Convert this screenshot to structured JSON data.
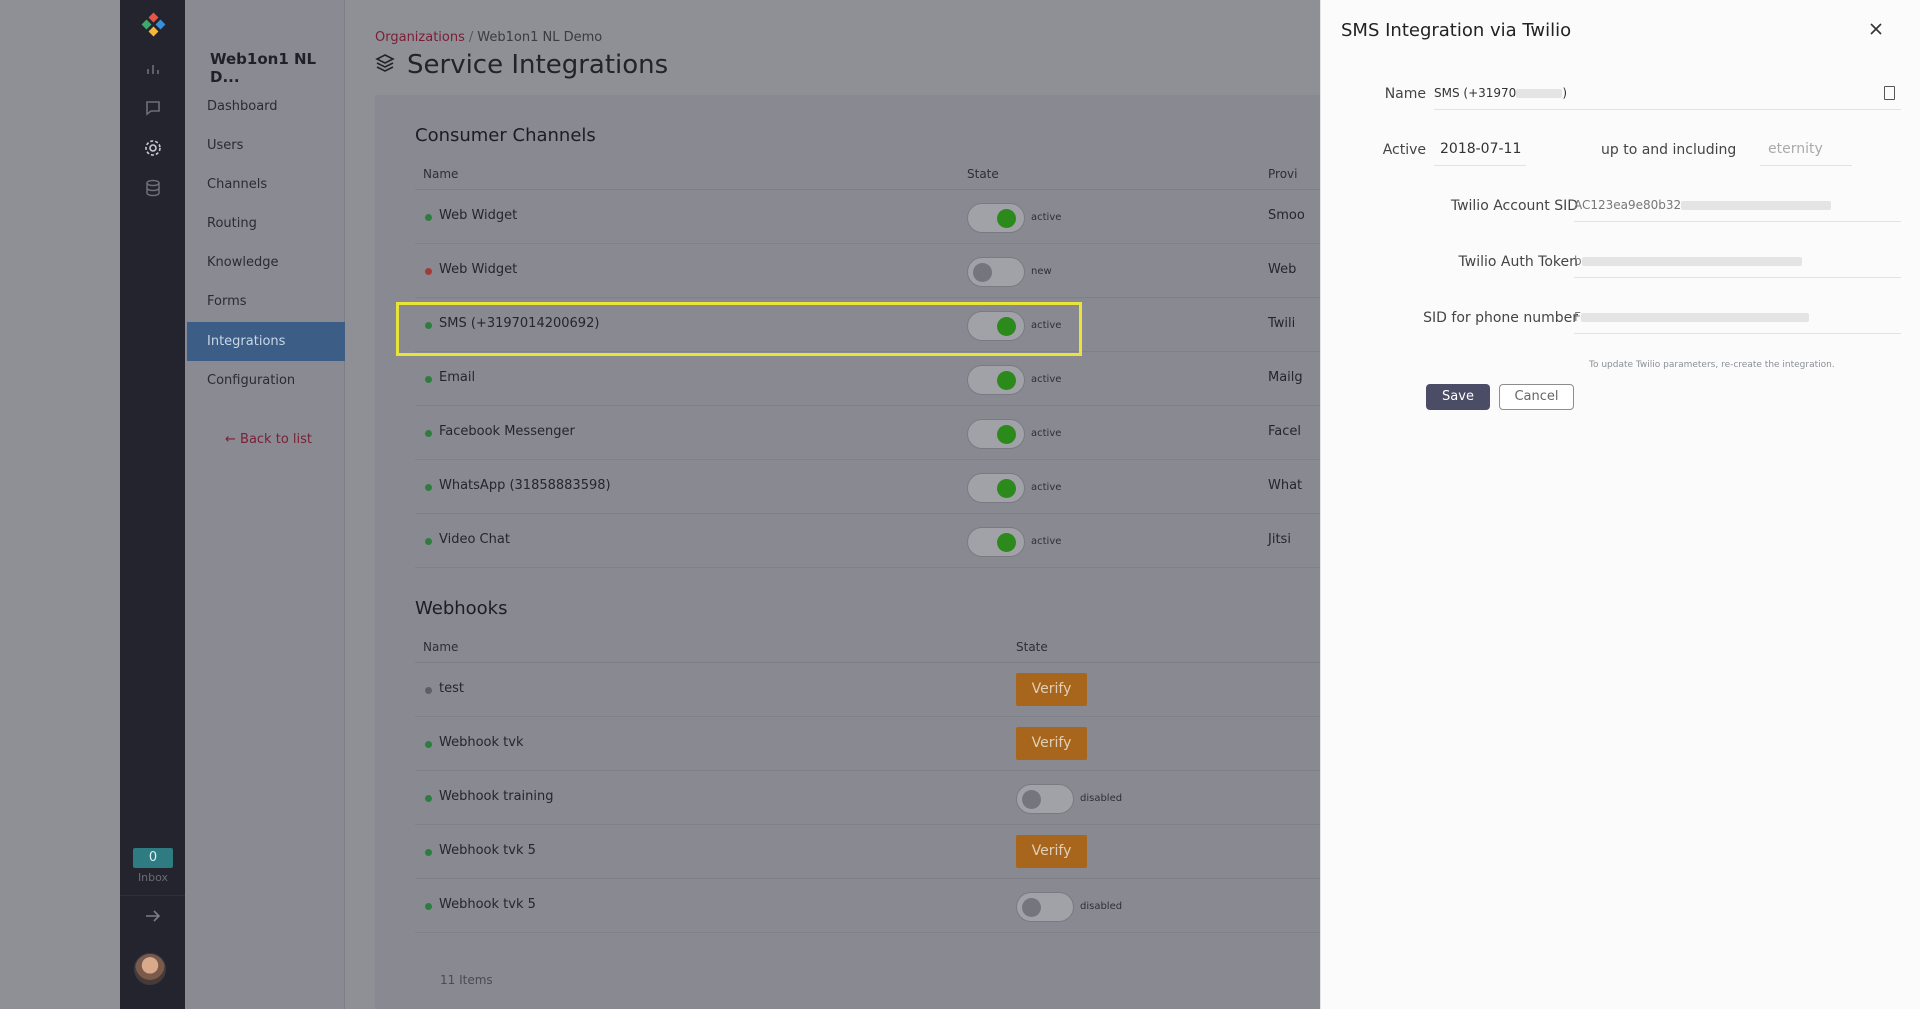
{
  "sidebar": {
    "org_name": "Web1on1 NL D...",
    "items": [
      {
        "label": "Dashboard"
      },
      {
        "label": "Users"
      },
      {
        "label": "Channels"
      },
      {
        "label": "Routing"
      },
      {
        "label": "Knowledge"
      },
      {
        "label": "Forms"
      },
      {
        "label": "Integrations",
        "active": true
      },
      {
        "label": "Configuration"
      }
    ],
    "back_label": "← Back to list"
  },
  "rail": {
    "icons": [
      "logo-icon",
      "chart-icon",
      "chat-icon",
      "gear-icon",
      "database-icon"
    ],
    "inbox_count": "0",
    "inbox_label": "Inbox"
  },
  "header": {
    "breadcrumb_root": "Organizations",
    "breadcrumb_sep": "/",
    "breadcrumb_current": "Web1on1 NL Demo",
    "title": "Service Integrations"
  },
  "consumer_channels": {
    "title": "Consumer Channels",
    "col_name": "Name",
    "col_state": "State",
    "col_provider": "Provi",
    "rows": [
      {
        "name": "Web Widget",
        "state": "active",
        "on": true,
        "provider": "Smoo",
        "dot": "green"
      },
      {
        "name": "Web Widget",
        "state": "new",
        "on": false,
        "provider": "Web",
        "dot": "red"
      },
      {
        "name": "SMS (+3197014200692)",
        "state": "active",
        "on": true,
        "provider": "Twili",
        "dot": "green"
      },
      {
        "name": "Email",
        "state": "active",
        "on": true,
        "provider": "Mailg",
        "dot": "green"
      },
      {
        "name": "Facebook Messenger",
        "state": "active",
        "on": true,
        "provider": "Facel",
        "dot": "green"
      },
      {
        "name": "WhatsApp (31858883598)",
        "state": "active",
        "on": true,
        "provider": "What",
        "dot": "green"
      },
      {
        "name": "Video Chat",
        "state": "active",
        "on": true,
        "provider": "Jitsi",
        "dot": "green"
      }
    ]
  },
  "webhooks": {
    "title": "Webhooks",
    "col_name": "Name",
    "col_state": "State",
    "verify_label": "Verify",
    "rows": [
      {
        "name": "test",
        "kind": "verify",
        "dot": "grey"
      },
      {
        "name": "Webhook tvk",
        "kind": "verify",
        "dot": "green"
      },
      {
        "name": "Webhook training",
        "kind": "toggle",
        "state": "disabled",
        "dot": "green"
      },
      {
        "name": "Webhook tvk 5",
        "kind": "verify",
        "dot": "green"
      },
      {
        "name": "Webhook tvk 5",
        "kind": "toggle",
        "state": "disabled",
        "dot": "green"
      }
    ],
    "item_count": "11 Items"
  },
  "panel": {
    "title": "SMS Integration via Twilio",
    "name_label": "Name",
    "name_value": "SMS (+31970",
    "name_value_end": ")",
    "active_label": "Active",
    "active_from": "2018-07-11",
    "active_sep": "up to and including",
    "active_until_placeholder": "eternity",
    "sid_label": "Twilio Account SID",
    "sid_value": "AC123ea9e80b32",
    "token_label": "Twilio Auth Token",
    "token_value": "b",
    "phone_sid_label": "SID for phone number",
    "phone_sid_value": "F",
    "note": "To update Twilio parameters, re-create the integration.",
    "save_label": "Save",
    "cancel_label": "Cancel"
  },
  "colors": {
    "accent": "#4b4c66",
    "link": "#7a1e35",
    "active_nav": "#3b5d86",
    "toggle_on": "#2c8a1d",
    "verify": "#a7661c",
    "highlight": "#e9e43c"
  }
}
